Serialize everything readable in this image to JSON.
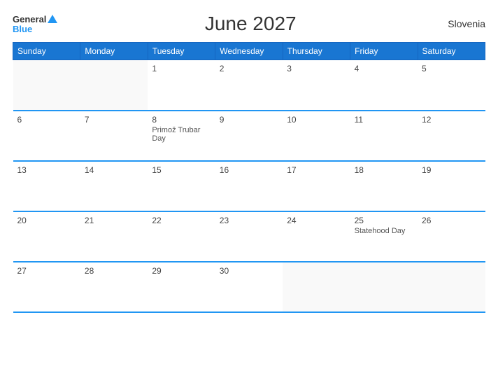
{
  "header": {
    "logo_general": "General",
    "logo_blue": "Blue",
    "title": "June 2027",
    "country": "Slovenia"
  },
  "weekdays": [
    "Sunday",
    "Monday",
    "Tuesday",
    "Wednesday",
    "Thursday",
    "Friday",
    "Saturday"
  ],
  "weeks": [
    [
      {
        "day": "",
        "empty": true
      },
      {
        "day": "",
        "empty": true
      },
      {
        "day": "1",
        "holiday": ""
      },
      {
        "day": "2",
        "holiday": ""
      },
      {
        "day": "3",
        "holiday": ""
      },
      {
        "day": "4",
        "holiday": ""
      },
      {
        "day": "5",
        "holiday": ""
      }
    ],
    [
      {
        "day": "6",
        "holiday": ""
      },
      {
        "day": "7",
        "holiday": ""
      },
      {
        "day": "8",
        "holiday": "Primož Trubar Day"
      },
      {
        "day": "9",
        "holiday": ""
      },
      {
        "day": "10",
        "holiday": ""
      },
      {
        "day": "11",
        "holiday": ""
      },
      {
        "day": "12",
        "holiday": ""
      }
    ],
    [
      {
        "day": "13",
        "holiday": ""
      },
      {
        "day": "14",
        "holiday": ""
      },
      {
        "day": "15",
        "holiday": ""
      },
      {
        "day": "16",
        "holiday": ""
      },
      {
        "day": "17",
        "holiday": ""
      },
      {
        "day": "18",
        "holiday": ""
      },
      {
        "day": "19",
        "holiday": ""
      }
    ],
    [
      {
        "day": "20",
        "holiday": ""
      },
      {
        "day": "21",
        "holiday": ""
      },
      {
        "day": "22",
        "holiday": ""
      },
      {
        "day": "23",
        "holiday": ""
      },
      {
        "day": "24",
        "holiday": ""
      },
      {
        "day": "25",
        "holiday": "Statehood Day"
      },
      {
        "day": "26",
        "holiday": ""
      }
    ],
    [
      {
        "day": "27",
        "holiday": ""
      },
      {
        "day": "28",
        "holiday": ""
      },
      {
        "day": "29",
        "holiday": ""
      },
      {
        "day": "30",
        "holiday": ""
      },
      {
        "day": "",
        "empty": true
      },
      {
        "day": "",
        "empty": true
      },
      {
        "day": "",
        "empty": true
      }
    ]
  ]
}
